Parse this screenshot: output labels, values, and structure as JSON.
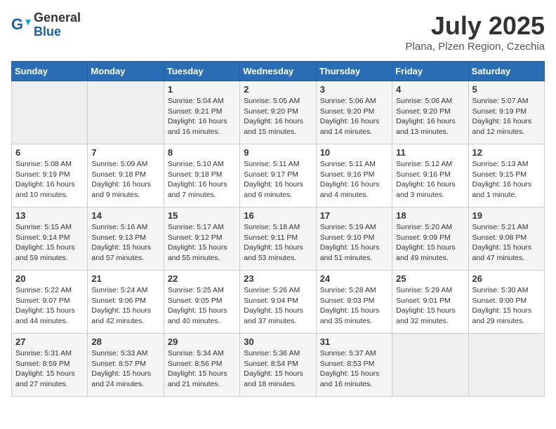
{
  "header": {
    "logo_general": "General",
    "logo_blue": "Blue",
    "month_title": "July 2025",
    "location": "Plana, Plzen Region, Czechia"
  },
  "weekdays": [
    "Sunday",
    "Monday",
    "Tuesday",
    "Wednesday",
    "Thursday",
    "Friday",
    "Saturday"
  ],
  "weeks": [
    [
      {
        "day": "",
        "detail": ""
      },
      {
        "day": "",
        "detail": ""
      },
      {
        "day": "1",
        "detail": "Sunrise: 5:04 AM\nSunset: 9:21 PM\nDaylight: 16 hours\nand 16 minutes."
      },
      {
        "day": "2",
        "detail": "Sunrise: 5:05 AM\nSunset: 9:20 PM\nDaylight: 16 hours\nand 15 minutes."
      },
      {
        "day": "3",
        "detail": "Sunrise: 5:06 AM\nSunset: 9:20 PM\nDaylight: 16 hours\nand 14 minutes."
      },
      {
        "day": "4",
        "detail": "Sunrise: 5:06 AM\nSunset: 9:20 PM\nDaylight: 16 hours\nand 13 minutes."
      },
      {
        "day": "5",
        "detail": "Sunrise: 5:07 AM\nSunset: 9:19 PM\nDaylight: 16 hours\nand 12 minutes."
      }
    ],
    [
      {
        "day": "6",
        "detail": "Sunrise: 5:08 AM\nSunset: 9:19 PM\nDaylight: 16 hours\nand 10 minutes."
      },
      {
        "day": "7",
        "detail": "Sunrise: 5:09 AM\nSunset: 9:18 PM\nDaylight: 16 hours\nand 9 minutes."
      },
      {
        "day": "8",
        "detail": "Sunrise: 5:10 AM\nSunset: 9:18 PM\nDaylight: 16 hours\nand 7 minutes."
      },
      {
        "day": "9",
        "detail": "Sunrise: 5:11 AM\nSunset: 9:17 PM\nDaylight: 16 hours\nand 6 minutes."
      },
      {
        "day": "10",
        "detail": "Sunrise: 5:11 AM\nSunset: 9:16 PM\nDaylight: 16 hours\nand 4 minutes."
      },
      {
        "day": "11",
        "detail": "Sunrise: 5:12 AM\nSunset: 9:16 PM\nDaylight: 16 hours\nand 3 minutes."
      },
      {
        "day": "12",
        "detail": "Sunrise: 5:13 AM\nSunset: 9:15 PM\nDaylight: 16 hours\nand 1 minute."
      }
    ],
    [
      {
        "day": "13",
        "detail": "Sunrise: 5:15 AM\nSunset: 9:14 PM\nDaylight: 15 hours\nand 59 minutes."
      },
      {
        "day": "14",
        "detail": "Sunrise: 5:16 AM\nSunset: 9:13 PM\nDaylight: 15 hours\nand 57 minutes."
      },
      {
        "day": "15",
        "detail": "Sunrise: 5:17 AM\nSunset: 9:12 PM\nDaylight: 15 hours\nand 55 minutes."
      },
      {
        "day": "16",
        "detail": "Sunrise: 5:18 AM\nSunset: 9:11 PM\nDaylight: 15 hours\nand 53 minutes."
      },
      {
        "day": "17",
        "detail": "Sunrise: 5:19 AM\nSunset: 9:10 PM\nDaylight: 15 hours\nand 51 minutes."
      },
      {
        "day": "18",
        "detail": "Sunrise: 5:20 AM\nSunset: 9:09 PM\nDaylight: 15 hours\nand 49 minutes."
      },
      {
        "day": "19",
        "detail": "Sunrise: 5:21 AM\nSunset: 9:08 PM\nDaylight: 15 hours\nand 47 minutes."
      }
    ],
    [
      {
        "day": "20",
        "detail": "Sunrise: 5:22 AM\nSunset: 9:07 PM\nDaylight: 15 hours\nand 44 minutes."
      },
      {
        "day": "21",
        "detail": "Sunrise: 5:24 AM\nSunset: 9:06 PM\nDaylight: 15 hours\nand 42 minutes."
      },
      {
        "day": "22",
        "detail": "Sunrise: 5:25 AM\nSunset: 9:05 PM\nDaylight: 15 hours\nand 40 minutes."
      },
      {
        "day": "23",
        "detail": "Sunrise: 5:26 AM\nSunset: 9:04 PM\nDaylight: 15 hours\nand 37 minutes."
      },
      {
        "day": "24",
        "detail": "Sunrise: 5:28 AM\nSunset: 9:03 PM\nDaylight: 15 hours\nand 35 minutes."
      },
      {
        "day": "25",
        "detail": "Sunrise: 5:29 AM\nSunset: 9:01 PM\nDaylight: 15 hours\nand 32 minutes."
      },
      {
        "day": "26",
        "detail": "Sunrise: 5:30 AM\nSunset: 9:00 PM\nDaylight: 15 hours\nand 29 minutes."
      }
    ],
    [
      {
        "day": "27",
        "detail": "Sunrise: 5:31 AM\nSunset: 8:59 PM\nDaylight: 15 hours\nand 27 minutes."
      },
      {
        "day": "28",
        "detail": "Sunrise: 5:33 AM\nSunset: 8:57 PM\nDaylight: 15 hours\nand 24 minutes."
      },
      {
        "day": "29",
        "detail": "Sunrise: 5:34 AM\nSunset: 8:56 PM\nDaylight: 15 hours\nand 21 minutes."
      },
      {
        "day": "30",
        "detail": "Sunrise: 5:36 AM\nSunset: 8:54 PM\nDaylight: 15 hours\nand 18 minutes."
      },
      {
        "day": "31",
        "detail": "Sunrise: 5:37 AM\nSunset: 8:53 PM\nDaylight: 15 hours\nand 16 minutes."
      },
      {
        "day": "",
        "detail": ""
      },
      {
        "day": "",
        "detail": ""
      }
    ]
  ]
}
